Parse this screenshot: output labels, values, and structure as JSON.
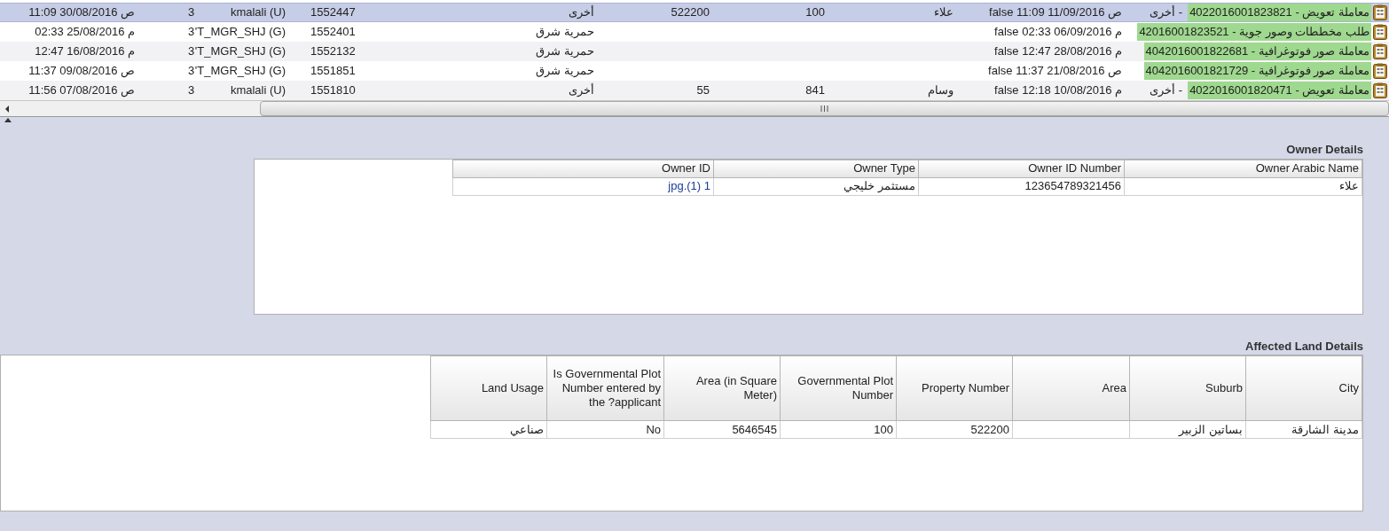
{
  "grid": {
    "rows": [
      {
        "selected": true,
        "created": "11:09 30/08/2016 ص",
        "count": "3",
        "user": "kmalali (U)",
        "id": "1552447",
        "location": "أخرى",
        "value_1": "522200",
        "value_2": "100",
        "name": "علاء",
        "flag": "false",
        "date": "11:09 11/09/2016 ص",
        "transaction": "معاملة تعويض - 4022016001823821",
        "type": "- أخرى"
      },
      {
        "selected": false,
        "created": "02:33 25/08/2016 م",
        "count": "3",
        "user": "'T_MGR_SHJ (G)",
        "id": "1552401",
        "location": "حمرية شرق",
        "flag": "false",
        "date": "02:33 06/09/2016 م",
        "transaction": "طلب مخططات وصور جوية - 42016001823521"
      },
      {
        "selected": false,
        "created": "12:47 16/08/2016 م",
        "count": "3",
        "user": "'T_MGR_SHJ (G)",
        "id": "1552132",
        "location": "حمرية شرق",
        "flag": "false",
        "date": "12:47 28/08/2016 م",
        "transaction": "معاملة صور فوتوغرافية - 4042016001822681"
      },
      {
        "selected": false,
        "created": "11:37 09/08/2016 ص",
        "count": "3",
        "user": "'T_MGR_SHJ (G)",
        "id": "1551851",
        "location": "حمرية شرق",
        "flag": "false",
        "date": "11:37 21/08/2016 ص",
        "transaction": "معاملة صور فوتوغرافية - 4042016001821729"
      },
      {
        "selected": false,
        "created": "11:56 07/08/2016 ص",
        "count": "3",
        "user": "kmalali (U)",
        "id": "1551810",
        "location": "أخرى",
        "value_1": "55",
        "value_2": "841",
        "name": "وسام",
        "flag": "false",
        "date": "12:18 10/08/2016 م",
        "transaction": "معاملة تعويض - 4022016001820471",
        "type": "- أخرى"
      }
    ]
  },
  "owner_details": {
    "title": "Owner Details",
    "columns": [
      "Owner Arabic Name",
      "Owner ID Number",
      "Owner Type",
      "Owner ID"
    ],
    "rows": [
      [
        {
          "text": "علاء",
          "link": false
        },
        {
          "text": "123654789321456",
          "link": false
        },
        {
          "text": "مستثمر خليجي",
          "link": false
        },
        {
          "text": "jpg.(1) 1",
          "link": true
        }
      ]
    ]
  },
  "affected_land": {
    "title": "Affected Land Details",
    "columns": [
      "City",
      "Suburb",
      "Area",
      "Property Number",
      "Governmental Plot Number",
      "Area (in Square Meter)",
      "Is Governmental Plot Number entered by the ?applicant",
      "Land Usage"
    ],
    "rows": [
      [
        "مدينة الشارقة",
        "بساتين الزبير",
        null,
        "522200",
        "100",
        "5646545",
        "No",
        "صناعي"
      ]
    ]
  }
}
